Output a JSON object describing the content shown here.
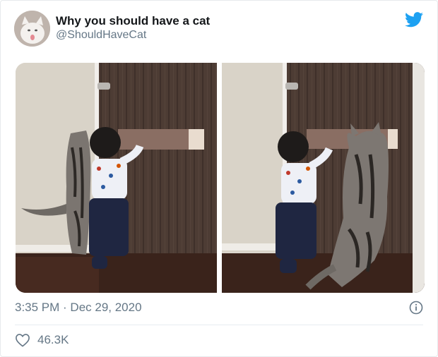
{
  "tweet": {
    "author_name": "Why you should have a cat",
    "author_handle": "@ShouldHaveCat",
    "timestamp": "3:35 PM · Dec 29, 2020",
    "likes": "46.3K"
  },
  "icons": {
    "brand": "twitter-bird-icon",
    "info": "info-icon",
    "like": "heart-icon"
  },
  "colors": {
    "twitter_blue": "#1da1f2",
    "secondary_text": "#657786",
    "primary_text": "#14171a"
  }
}
